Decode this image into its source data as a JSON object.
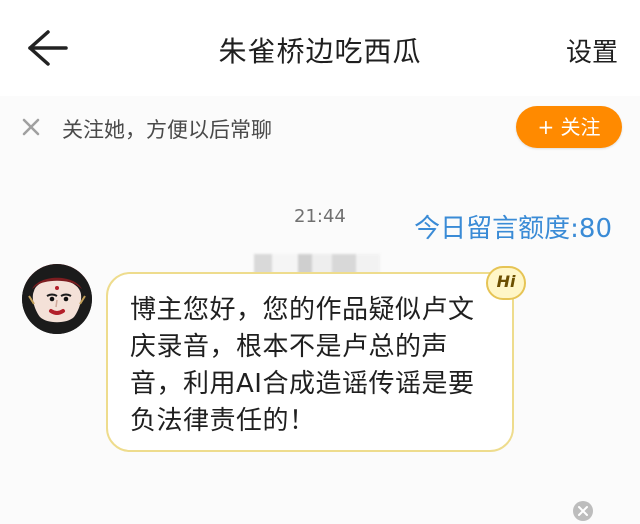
{
  "header": {
    "title": "朱雀桥边吃西瓜",
    "settings_label": "设置"
  },
  "follow_bar": {
    "tip": "关注她，方便以后常聊",
    "button_label": "+ 关注"
  },
  "chat": {
    "timestamp": "21:44",
    "quota": "今日留言额度:80",
    "message": "博主您好，您的作品疑似卢文庆录音，根本不是卢总的声音，利用AI合成造谣传谣是要负法律责任的！",
    "badge": "Hi"
  },
  "colors": {
    "accent": "#ff8a00",
    "quota_text": "#3a8bd6",
    "bubble_border": "#eedc8d",
    "badge_fill": "#fff6c7"
  },
  "icons": {
    "back": "back-arrow-icon",
    "close": "close-icon",
    "avatar": "avatar-image",
    "hi_badge": "hi-badge-icon"
  }
}
